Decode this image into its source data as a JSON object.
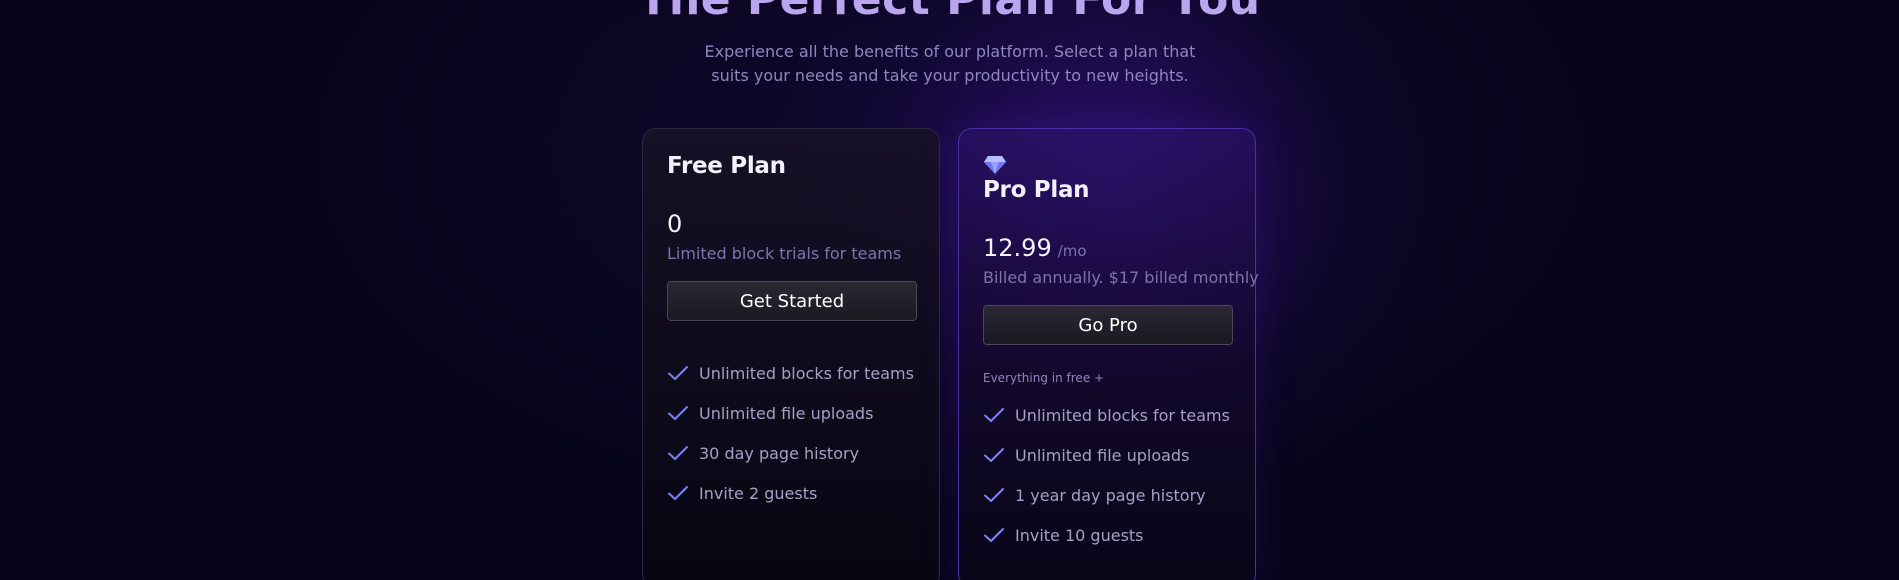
{
  "hero": {
    "title": "The Perfect Plan For You",
    "subtitle_line1": "Experience all the benefits of our platform. Select a plan that",
    "subtitle_line2": "suits your needs and take your productivity to new heights."
  },
  "plans": [
    {
      "name": "Free Plan",
      "price": "0",
      "note": "Limited block trials for teams",
      "cta": "Get Started",
      "features": [
        "Unlimited blocks for teams",
        "Unlimited file uploads",
        "30 day page history",
        "Invite 2 guests"
      ]
    },
    {
      "name": "Pro Plan",
      "icon": "diamond-icon",
      "price": "12.99",
      "per": "/mo",
      "note": "Billed annually. $17 billed monthly",
      "cta": "Go Pro",
      "section_label": "Everything in free +",
      "features": [
        "Unlimited blocks for teams",
        "Unlimited file uploads",
        "1 year day page history",
        "Invite 10 guests"
      ]
    }
  ],
  "colors": {
    "accent": "#7c83f5",
    "background": "#07051a",
    "pro_border": "#4a2fa6"
  }
}
